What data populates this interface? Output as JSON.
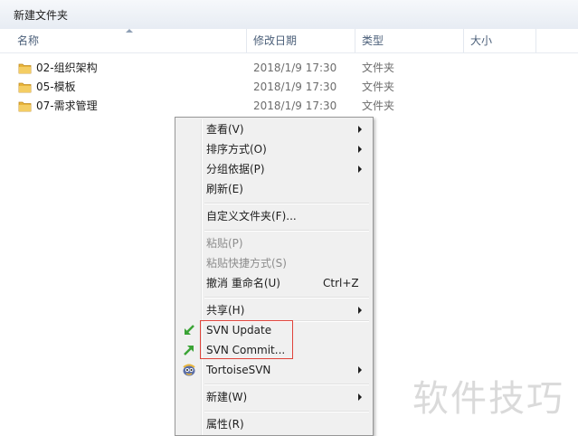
{
  "window": {
    "title": "新建文件夹"
  },
  "columns": {
    "name": "名称",
    "date": "修改日期",
    "type": "类型",
    "size": "大小"
  },
  "files": [
    {
      "name": "02-组织架构",
      "date": "2018/1/9 17:30",
      "type": "文件夹"
    },
    {
      "name": "05-模板",
      "date": "2018/1/9 17:30",
      "type": "文件夹"
    },
    {
      "name": "07-需求管理",
      "date": "2018/1/9 17:30",
      "type": "文件夹"
    }
  ],
  "context_menu": {
    "view": "查看(V)",
    "sort": "排序方式(O)",
    "group": "分组依据(P)",
    "refresh": "刷新(E)",
    "customize": "自定义文件夹(F)...",
    "paste": "粘贴(P)",
    "paste_shortcut": "粘贴快捷方式(S)",
    "undo": "撤消 重命名(U)",
    "undo_shortcut": "Ctrl+Z",
    "share": "共享(H)",
    "svn_update": "SVN Update",
    "svn_commit": "SVN Commit...",
    "tortoise": "TortoiseSVN",
    "new": "新建(W)",
    "properties": "属性(R)"
  },
  "watermark": "软件技巧",
  "colors": {
    "folder": "#e8b43a",
    "highlight_box": "#e0433a",
    "svn_green": "#3aa335"
  }
}
